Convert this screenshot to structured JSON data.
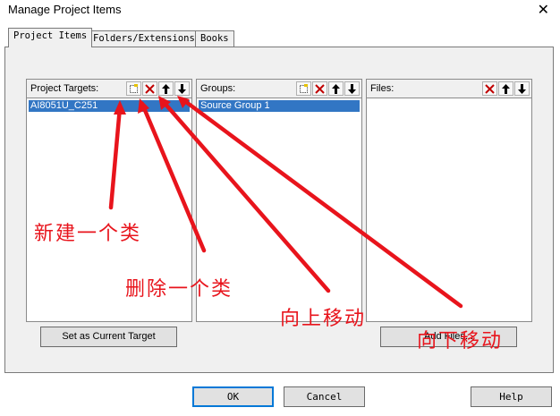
{
  "window": {
    "title": "Manage Project Items",
    "close_glyph": "✕"
  },
  "tabs": [
    {
      "label": "Project Items",
      "active": true
    },
    {
      "label": "Folders/Extensions",
      "active": false
    },
    {
      "label": "Books",
      "active": false
    }
  ],
  "targets_pane": {
    "label": "Project Targets:",
    "items": [
      "AI8051U_C251"
    ],
    "selected_index": 0,
    "tools": [
      "new-icon",
      "delete-icon",
      "up-arrow-icon",
      "down-arrow-icon"
    ]
  },
  "groups_pane": {
    "label": "Groups:",
    "items": [
      "Source Group 1"
    ],
    "selected_index": 0,
    "tools": [
      "new-icon",
      "delete-icon",
      "up-arrow-icon",
      "down-arrow-icon"
    ]
  },
  "files_pane": {
    "label": "Files:",
    "items": [],
    "tools": [
      "delete-icon",
      "up-arrow-icon",
      "down-arrow-icon"
    ]
  },
  "buttons": {
    "set_current_target": "Set as Current Target",
    "add_files": "Add Files...",
    "ok": "OK",
    "cancel": "Cancel",
    "help": "Help"
  },
  "annotations": {
    "new_class": "新建一个类",
    "delete_class": "删除一个类",
    "move_up": "向上移动",
    "move_down": "向下移动",
    "color": "#e8141c"
  }
}
